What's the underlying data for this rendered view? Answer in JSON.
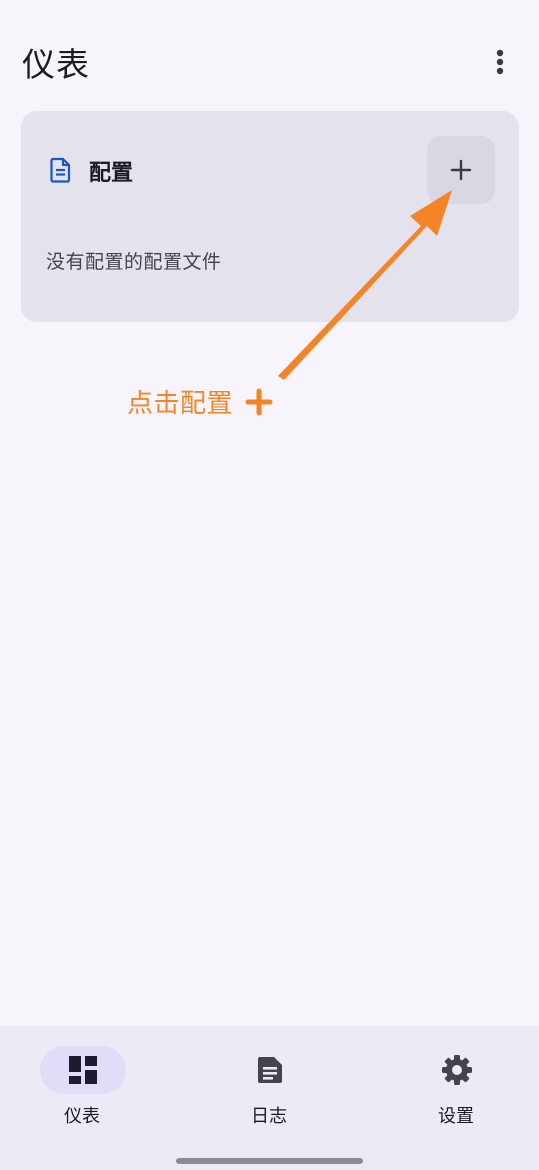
{
  "app_bar": {
    "title": "仪表",
    "menu_icon": "more-vert-icon"
  },
  "profiles_card": {
    "icon": "document-icon",
    "title": "配置",
    "add_icon": "plus-icon",
    "empty_message": "没有配置的配置文件"
  },
  "annotation": {
    "text": "点击配置",
    "color": "#f58426",
    "icon": "plus-icon"
  },
  "bottom_nav": {
    "items": [
      {
        "label": "仪表",
        "icon": "dashboard-icon",
        "active": true
      },
      {
        "label": "日志",
        "icon": "log-icon",
        "active": false
      },
      {
        "label": "设置",
        "icon": "gear-icon",
        "active": false
      }
    ]
  },
  "colors": {
    "accent": "#1a56c4",
    "annotation": "#f58426",
    "active_pill": "#e3dcf8"
  }
}
